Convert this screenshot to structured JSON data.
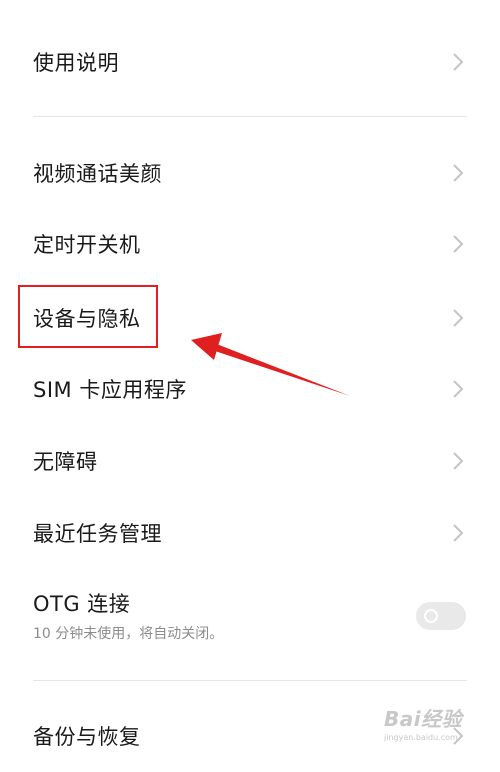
{
  "settings": {
    "items": [
      {
        "label": "使用说明"
      },
      {
        "label": "视频通话美颜"
      },
      {
        "label": "定时开关机"
      },
      {
        "label": "设备与隐私"
      },
      {
        "label": "SIM 卡应用程序"
      },
      {
        "label": "无障碍"
      },
      {
        "label": "最近任务管理"
      }
    ],
    "otg": {
      "label": "OTG 连接",
      "subtitle": "10 分钟未使用，将自动关闭。",
      "enabled": false
    },
    "backup": {
      "label": "备份与恢复"
    }
  },
  "annotation": {
    "highlight_color": "#e02020",
    "highlighted_item": "设备与隐私"
  },
  "watermark": {
    "logo": "Bai经验",
    "url": "jingyan.baidu.com"
  }
}
